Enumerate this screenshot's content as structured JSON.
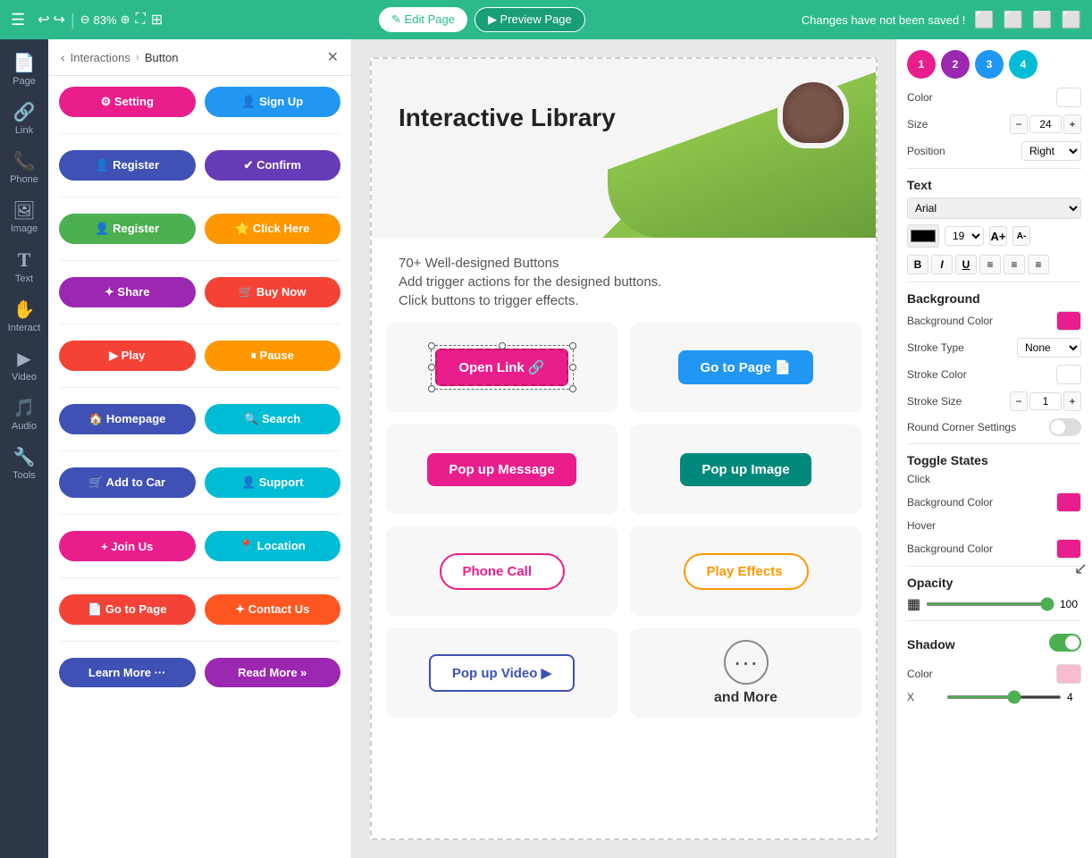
{
  "topbar": {
    "menu_icon": "☰",
    "undo_icon": "↩",
    "redo_icon": "↪",
    "zoom_out_icon": "⊖",
    "zoom_level": "83%",
    "zoom_in_icon": "⊕",
    "expand_icon": "⛶",
    "grid_icon": "⊞",
    "edit_label": "✎ Edit Page",
    "preview_label": "▶ Preview Page",
    "unsaved_notice": "Changes have not been saved !",
    "icon1": "⬜",
    "icon2": "⬜",
    "icon3": "⬜",
    "icon4": "⬜"
  },
  "sidebar": {
    "items": [
      {
        "name": "Page",
        "icon": "📄"
      },
      {
        "name": "Link",
        "icon": "🔗"
      },
      {
        "name": "Phone",
        "icon": "📞"
      },
      {
        "name": "Image",
        "icon": "🖼"
      },
      {
        "name": "Text",
        "icon": "T"
      },
      {
        "name": "Interact",
        "icon": "✋"
      },
      {
        "name": "Video",
        "icon": "▶"
      },
      {
        "name": "Audio",
        "icon": "🎵"
      },
      {
        "name": "Tools",
        "icon": "🔧"
      }
    ]
  },
  "panel": {
    "breadcrumb": "Interactions",
    "active": "Button",
    "buttons": [
      {
        "label": "Setting",
        "bg": "#e91e8c",
        "icon": "⚙"
      },
      {
        "label": "Sign Up",
        "bg": "#2196f3",
        "icon": "👤"
      },
      {
        "label": "Register",
        "bg": "#3f51b5",
        "icon": "👤"
      },
      {
        "label": "Confirm",
        "bg": "#673ab7",
        "icon": "✔"
      },
      {
        "label": "Register",
        "bg": "#4caf50",
        "icon": "👤"
      },
      {
        "label": "Click Here",
        "bg": "#ff9800",
        "icon": "⭐"
      },
      {
        "label": "Share",
        "bg": "#9c27b0",
        "icon": "✦"
      },
      {
        "label": "Buy Now",
        "bg": "#f44336",
        "icon": "🛒"
      },
      {
        "label": "Play",
        "bg": "#f44336",
        "icon": "▶"
      },
      {
        "label": "Pause",
        "bg": "#ff9800",
        "icon": "⏸"
      },
      {
        "label": "Homepage",
        "bg": "#3f51b5",
        "icon": "🏠"
      },
      {
        "label": "Search",
        "bg": "#00bcd4",
        "icon": "🔍"
      },
      {
        "label": "Add to Car",
        "bg": "#3f51b5",
        "icon": "🛒"
      },
      {
        "label": "Support",
        "bg": "#00bcd4",
        "icon": "👤"
      },
      {
        "label": "Join Us",
        "bg": "#e91e8c",
        "icon": "+"
      },
      {
        "label": "Location",
        "bg": "#00bcd4",
        "icon": "📍"
      },
      {
        "label": "Go to Page",
        "bg": "#f44336",
        "icon": "📄"
      },
      {
        "label": "Contact Us",
        "bg": "#ff5722",
        "icon": "✦"
      },
      {
        "label": "Learn More",
        "bg": "#3f51b5",
        "icon": "···"
      },
      {
        "label": "Read More",
        "bg": "#9c27b0",
        "icon": "»"
      }
    ]
  },
  "canvas": {
    "title": "Interactive Library",
    "subtitle1": "70+ Well-designed Buttons",
    "subtitle2": "Add trigger actions for the designed buttons.",
    "subtitle3": "Click buttons to trigger effects.",
    "btn_open_link": "Open Link 🔗",
    "btn_go_to_page": "Go to Page 📄",
    "btn_popup_message": "Pop up Message",
    "btn_popup_image": "Pop up Image",
    "btn_phone_call": "Phone Call",
    "btn_play_effects": "Play Effects",
    "btn_popup_video": "Pop up Video ▶",
    "btn_and_more": "and More"
  },
  "props": {
    "color_label": "Color",
    "size_label": "Size",
    "size_value": "24",
    "position_label": "Position",
    "position_value": "Right",
    "text_section": "Text",
    "font_value": "Arial",
    "font_size": "19",
    "background_section": "Background",
    "bg_color_label": "Background Color",
    "stroke_type_label": "Stroke Type",
    "stroke_type_value": "None",
    "stroke_color_label": "Stroke Color",
    "stroke_size_label": "Stroke Size",
    "stroke_size_value": "1",
    "round_corner_label": "Round Corner Settings",
    "toggle_states_section": "Toggle States",
    "click_label": "Click",
    "click_bg_color_label": "Background Color",
    "hover_label": "Hover",
    "hover_bg_color_label": "Background Color",
    "opacity_section": "Opacity",
    "opacity_value": "100",
    "shadow_section": "Shadow",
    "shadow_color_label": "Color",
    "shadow_x_label": "X",
    "shadow_x_value": "4"
  }
}
